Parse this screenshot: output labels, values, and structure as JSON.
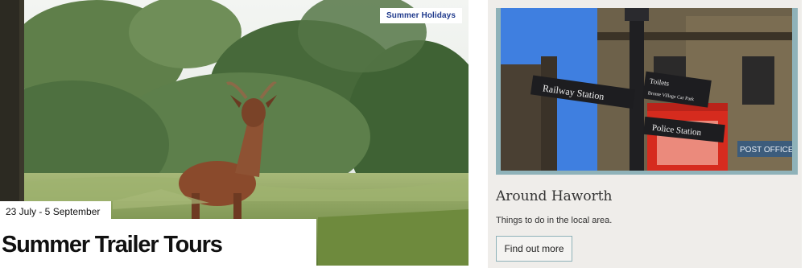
{
  "feature": {
    "tag": "Summer Holidays",
    "date": "23 July - 5 September",
    "title": "Summer Trailer Tours",
    "image": "deer-in-meadow-photo"
  },
  "card": {
    "title": "Around Haworth",
    "description": "Things to do in the local area.",
    "button_label": "Find out more",
    "image": "haworth-street-signpost-photo",
    "sign_labels": {
      "railway": "Railway Station",
      "toilets": "Toilets",
      "car_park": "Bronte Village Car Park",
      "police": "Police Station",
      "post_office": "POST OFFICE"
    }
  },
  "colors": {
    "tag_text": "#1f3a8c",
    "card_background": "#efedea",
    "accent_border": "#8fb2b9"
  }
}
